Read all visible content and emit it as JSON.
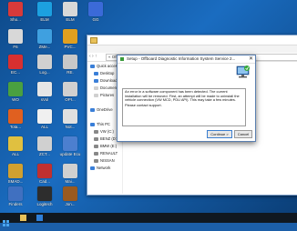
{
  "desktop_icons": [
    {
      "label": "Sho...",
      "color": "#d83a3a"
    },
    {
      "label": "ELM",
      "color": "#1ca0e0"
    },
    {
      "label": "ELM",
      "color": "#d8d8d8"
    },
    {
      "label": "GG",
      "color": "#3b6ad8"
    },
    {
      "label": "F6",
      "color": "#d8d8d8"
    },
    {
      "label": "ZMe...",
      "color": "#3fa0e0"
    },
    {
      "label": "PVC...",
      "color": "#e0a020"
    },
    {
      "label": "EC...",
      "color": "#d83030"
    },
    {
      "label": "Log...",
      "color": "#d0d0d0"
    },
    {
      "label": "RE.",
      "color": "#c8c8c8"
    },
    {
      "label": "WO",
      "color": "#4aa040"
    },
    {
      "label": "sVol",
      "color": "#e6e6e6"
    },
    {
      "label": "OPI...",
      "color": "#d0d0d0"
    },
    {
      "label": "Tota...",
      "color": "#e06020"
    },
    {
      "label": "ALL",
      "color": "#f0f0f0"
    },
    {
      "label": "Not...",
      "color": "#e0e0e0"
    },
    {
      "label": "ZH...",
      "color": "#3b7fd8"
    },
    {
      "label": "ALL",
      "color": "#e0c040"
    },
    {
      "label": "ZCT...",
      "color": "#d0d0d0"
    },
    {
      "label": "update Ecu",
      "color": "#4c7fcf"
    },
    {
      "label": "BMW ...",
      "color": "#2850a0"
    },
    {
      "label": "SMAD...",
      "color": "#d0a030"
    },
    {
      "label": "Cad...",
      "color": "#c03030"
    },
    {
      "label": "Mai...",
      "color": "#d0d0d0"
    },
    {
      "label": "ALL...",
      "color": "#c0c0c0"
    },
    {
      "label": "Finders",
      "color": "#4070c0"
    },
    {
      "label": "Logitech",
      "color": "#2d2d2d"
    },
    {
      "label": "Jon...",
      "color": "#9a5a20"
    }
  ],
  "explorer": {
    "path": "« OffboardDiagSetup_Service_V1.0...",
    "nav_items": [
      {
        "label": "Quick access",
        "color": "#3a7fd8",
        "sub": false
      },
      {
        "label": "Desktop",
        "color": "#3a7fd8",
        "sub": true
      },
      {
        "label": "Downloads",
        "color": "#3a7fd8",
        "sub": true
      },
      {
        "label": "Documents",
        "color": "#d0d0d0",
        "sub": true
      },
      {
        "label": "Pictures",
        "color": "#d0d0d0",
        "sub": true
      },
      {
        "label": "",
        "color": "#ffffff",
        "sub": false
      },
      {
        "label": "OneDrive",
        "color": "#3a7fd8",
        "sub": false
      },
      {
        "label": "",
        "color": "#ffffff",
        "sub": false
      },
      {
        "label": "This PC",
        "color": "#3a7fd8",
        "sub": false
      },
      {
        "label": "VW (C:)",
        "color": "#888888",
        "sub": true
      },
      {
        "label": "BENZ (D:)",
        "color": "#888888",
        "sub": true
      },
      {
        "label": "BMW (E:)",
        "color": "#888888",
        "sub": true
      },
      {
        "label": "RENAULT",
        "color": "#888888",
        "sub": true
      },
      {
        "label": "NISSAN",
        "color": "#888888",
        "sub": true
      },
      {
        "label": "Network",
        "color": "#3a7fd8",
        "sub": false
      }
    ]
  },
  "setup_dialog": {
    "title": "Setup - Offboard Diagnostic Information System Service 2...",
    "message": "An error in a software component has been detected. The current installation will be removed. First, an attempt will be made to uninstall the vehicle connection (VW MCD, PDU API). This may take a few minutes.",
    "support": "Please contact support.",
    "next_label": "Continue >",
    "cancel_label": "Cancel"
  }
}
